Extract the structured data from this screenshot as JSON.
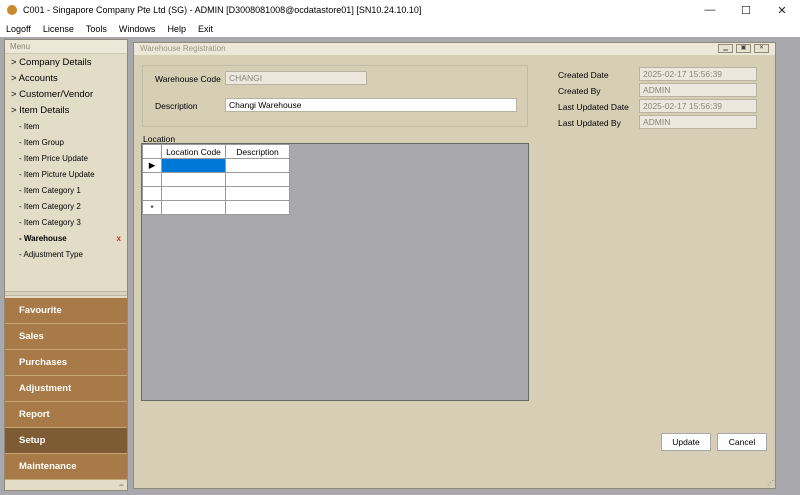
{
  "window": {
    "title": "C001 - Singapore Company Pte Ltd (SG) - ADMIN [D3008081008@ocdatastore01] [SN10.24.10.10]",
    "minimize": "—",
    "maximize": "☐",
    "close": "✕"
  },
  "menubar": [
    "Logoff",
    "License",
    "Tools",
    "Windows",
    "Help",
    "Exit"
  ],
  "sidebar": {
    "header": "Menu",
    "top_items": [
      "> Company Details",
      "> Accounts",
      "> Customer/Vendor",
      "> Item Details"
    ],
    "sub_items": [
      {
        "label": "- Item",
        "active": false
      },
      {
        "label": "- Item Group",
        "active": false
      },
      {
        "label": "- Item Price Update",
        "active": false
      },
      {
        "label": "- Item Picture Update",
        "active": false
      },
      {
        "label": "- Item Category 1",
        "active": false
      },
      {
        "label": "- Item Category 2",
        "active": false
      },
      {
        "label": "- Item Category 3",
        "active": false
      },
      {
        "label": "- Warehouse",
        "active": true
      },
      {
        "label": "- Adjustment Type",
        "active": false
      }
    ],
    "close_mark": "x",
    "modules": [
      {
        "label": "Favourite",
        "active": false
      },
      {
        "label": "Sales",
        "active": false
      },
      {
        "label": "Purchases",
        "active": false
      },
      {
        "label": "Adjustment",
        "active": false
      },
      {
        "label": "Report",
        "active": false
      },
      {
        "label": "Setup",
        "active": true
      },
      {
        "label": "Maintenance",
        "active": false
      }
    ]
  },
  "form": {
    "title": "Warehouse Registration",
    "warehouse_code_label": "Warehouse Code",
    "warehouse_code_value": "CHANGI",
    "description_label": "Description",
    "description_value": "Changi Warehouse",
    "created_date_label": "Created Date",
    "created_date_value": "2025-02-17 15:56:39",
    "created_by_label": "Created By",
    "created_by_value": "ADMIN",
    "last_updated_date_label": "Last Updated Date",
    "last_updated_date_value": "2025-02-17 15:56:39",
    "last_updated_by_label": "Last Updated By",
    "last_updated_by_value": "ADMIN",
    "location_label": "Location",
    "grid_headers": [
      "Location Code",
      "Description"
    ],
    "row_markers": [
      "▶",
      "",
      "",
      "*"
    ],
    "update_button": "Update",
    "cancel_button": "Cancel"
  },
  "colors": {
    "module_bg": "#a87a47",
    "module_active_bg": "#7d5c34",
    "panel_bg": "#e3dcc6",
    "form_bg": "#d6cfb6",
    "selection": "#0078d7"
  }
}
